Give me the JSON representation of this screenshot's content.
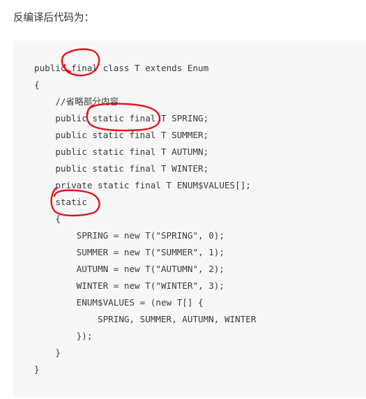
{
  "intro_text": "反编译后代码为：",
  "code_lines": [
    "public final class T extends Enum",
    "{",
    "    //省略部分内容",
    "    public static final T SPRING;",
    "    public static final T SUMMER;",
    "    public static final T AUTUMN;",
    "    public static final T WINTER;",
    "    private static final T ENUM$VALUES[];",
    "    static",
    "    {",
    "        SPRING = new T(\"SPRING\", 0);",
    "        SUMMER = new T(\"SUMMER\", 1);",
    "        AUTUMN = new T(\"AUTUMN\", 2);",
    "        WINTER = new T(\"WINTER\", 3);",
    "        ENUM$VALUES = (new T[] {",
    "            SPRING, SUMMER, AUTUMN, WINTER",
    "        });",
    "    }",
    "}"
  ],
  "annotation_color": "#e8121b"
}
